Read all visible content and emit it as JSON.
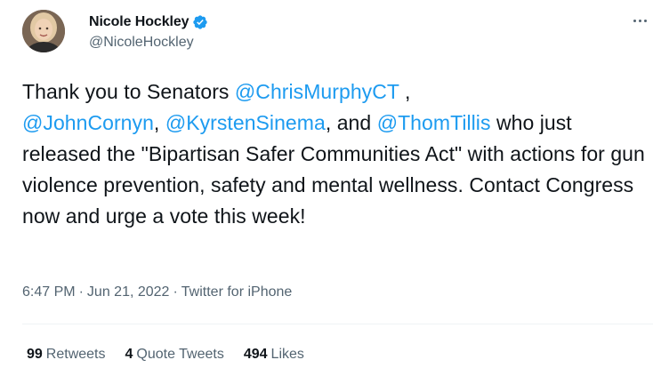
{
  "author": {
    "display_name": "Nicole Hockley",
    "handle": "@NicoleHockley",
    "verified": true
  },
  "tweet": {
    "text_parts": [
      {
        "text": "Thank you to Senators ",
        "mention": false
      },
      {
        "text": "@ChrisMurphyCT",
        "mention": true
      },
      {
        "text": " ,",
        "mention": false
      },
      {
        "text": "@JohnCornyn",
        "mention": true
      },
      {
        "text": ", ",
        "mention": false
      },
      {
        "text": "@KyrstenSinema",
        "mention": true
      },
      {
        "text": ", and ",
        "mention": false
      },
      {
        "text": "@ThomTillis",
        "mention": true
      },
      {
        "text": " who just released the \"Bipartisan Safer Communities Act\" with actions for gun violence prevention, safety and mental wellness. Contact Congress now and urge a vote this week!",
        "mention": false
      }
    ],
    "time": "6:47 PM",
    "date": "Jun 21, 2022",
    "source": "Twitter for iPhone"
  },
  "stats": {
    "retweets_count": "99",
    "retweets_label": "Retweets",
    "quotes_count": "4",
    "quotes_label": "Quote Tweets",
    "likes_count": "494",
    "likes_label": "Likes"
  },
  "icons": {
    "verified": "verified-badge-icon",
    "more": "more-options-icon"
  },
  "colors": {
    "mention": "#1d9bf0",
    "secondary_text": "#536471",
    "verified": "#1d9bf0"
  }
}
